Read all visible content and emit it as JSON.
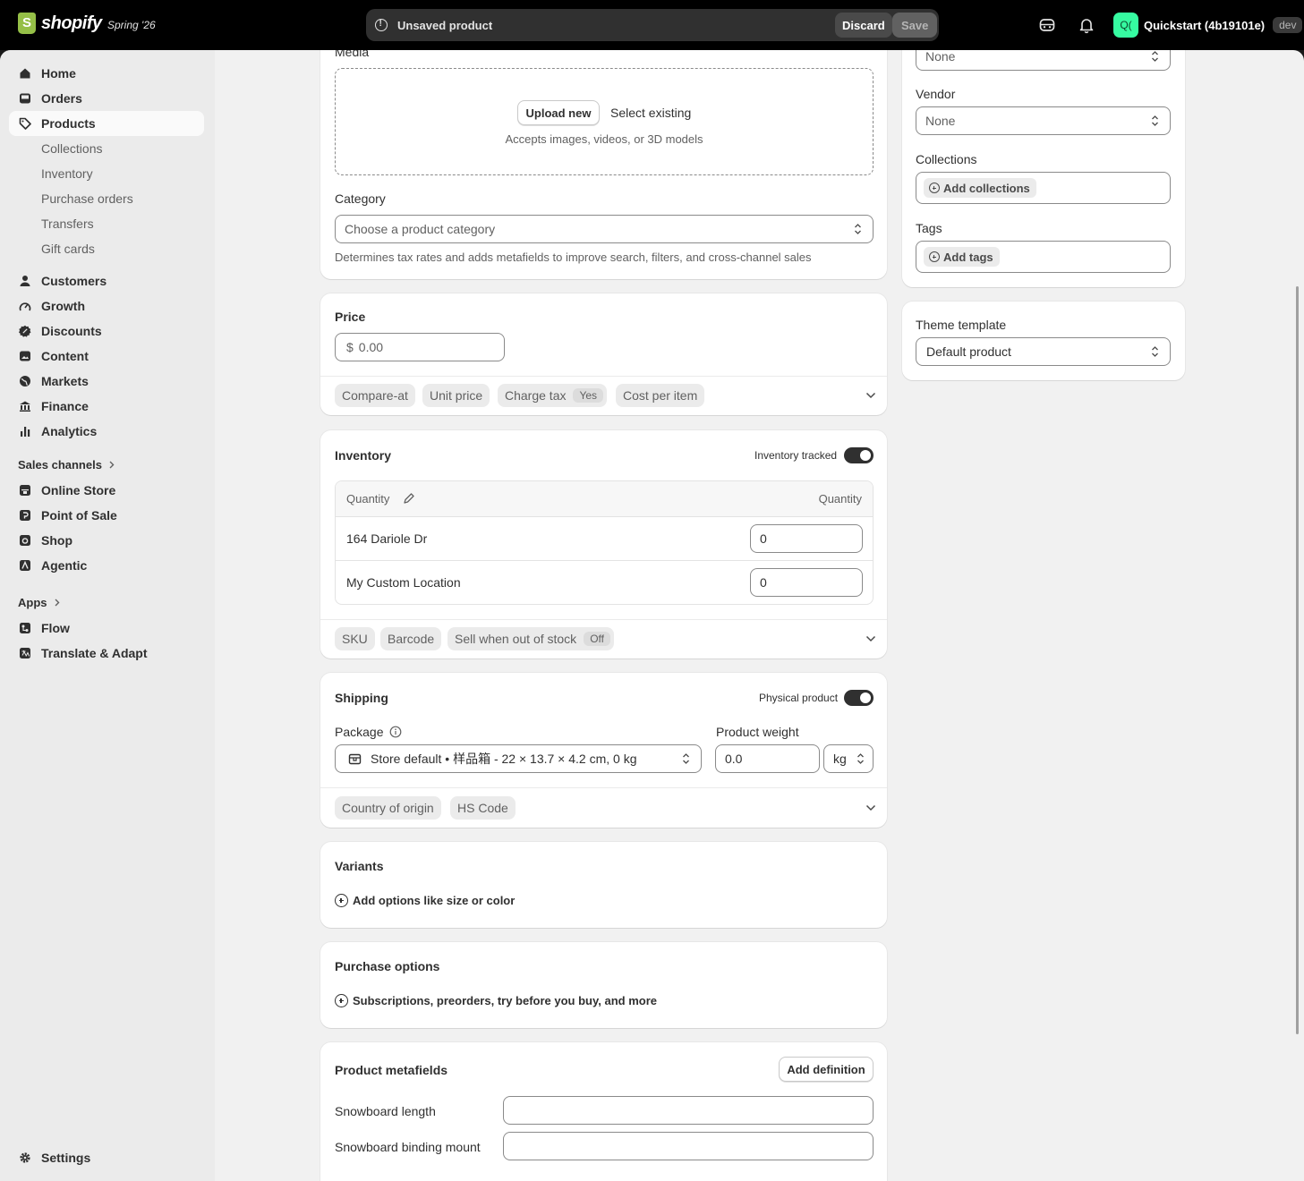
{
  "topbar": {
    "brand": "shopify",
    "edition": "Spring '26",
    "unsaved_text": "Unsaved product",
    "discard_label": "Discard",
    "save_label": "Save",
    "store_initials": "Q(",
    "store_name": "Quickstart (4b19101e)",
    "env_badge": "dev"
  },
  "sidebar": {
    "items_main": [
      {
        "label": "Home",
        "icon": "home-icon"
      },
      {
        "label": "Orders",
        "icon": "inbox-icon"
      },
      {
        "label": "Products",
        "icon": "tag-icon",
        "active": true
      }
    ],
    "product_sub": [
      "Collections",
      "Inventory",
      "Purchase orders",
      "Transfers",
      "Gift cards"
    ],
    "items_more": [
      {
        "label": "Customers",
        "icon": "person-icon"
      },
      {
        "label": "Growth",
        "icon": "gauge-icon"
      },
      {
        "label": "Discounts",
        "icon": "discount-icon"
      },
      {
        "label": "Content",
        "icon": "image-icon"
      },
      {
        "label": "Markets",
        "icon": "globe-icon"
      },
      {
        "label": "Finance",
        "icon": "bank-icon"
      },
      {
        "label": "Analytics",
        "icon": "bar-chart-icon"
      }
    ],
    "sales_channels_label": "Sales channels",
    "channels": [
      "Online Store",
      "Point of Sale",
      "Shop",
      "Agentic"
    ],
    "apps_label": "Apps",
    "apps": [
      "Flow",
      "Translate & Adapt"
    ],
    "settings_label": "Settings"
  },
  "media": {
    "label": "Media",
    "upload_label": "Upload new",
    "select_label": "Select existing",
    "hint": "Accepts images, videos, or 3D models"
  },
  "category": {
    "label": "Category",
    "placeholder": "Choose a product category",
    "help": "Determines tax rates and adds metafields to improve search, filters, and cross-channel sales"
  },
  "price": {
    "label": "Price",
    "currency": "$",
    "value": "0.00",
    "pills": {
      "compare_at": "Compare-at",
      "unit_price": "Unit price",
      "charge_tax": "Charge tax",
      "charge_tax_value": "Yes",
      "cost": "Cost per item"
    }
  },
  "inventory": {
    "title": "Inventory",
    "tracked_label": "Inventory tracked",
    "tracked": true,
    "header_left": "Quantity",
    "header_right": "Quantity",
    "locations": [
      {
        "name": "164 Dariole Dr",
        "qty": "0"
      },
      {
        "name": "My Custom Location",
        "qty": "0"
      }
    ],
    "pills": {
      "sku": "SKU",
      "barcode": "Barcode",
      "sell_oos": "Sell when out of stock",
      "sell_oos_value": "Off"
    }
  },
  "shipping": {
    "title": "Shipping",
    "physical_label": "Physical product",
    "physical": true,
    "package_label": "Package",
    "package_value": "Store default • 样品箱 - 22 × 13.7 × 4.2 cm, 0 kg",
    "weight_label": "Product weight",
    "weight_value": "0.0",
    "weight_unit": "kg",
    "pills": {
      "origin": "Country of origin",
      "hs": "HS Code"
    }
  },
  "variants": {
    "title": "Variants",
    "add_label": "Add options like size or color"
  },
  "purchase_options": {
    "title": "Purchase options",
    "add_label": "Subscriptions, preorders, try before you buy, and more"
  },
  "metafields": {
    "title": "Product metafields",
    "add_definition": "Add definition",
    "fields": [
      "Snowboard length",
      "Snowboard binding mount"
    ]
  },
  "organization": {
    "type_value": "None",
    "vendor_label": "Vendor",
    "vendor_value": "None",
    "collections_label": "Collections",
    "collections_chip": "Add collections",
    "tags_label": "Tags",
    "tags_chip": "Add tags"
  },
  "theme": {
    "label": "Theme template",
    "value": "Default product"
  }
}
